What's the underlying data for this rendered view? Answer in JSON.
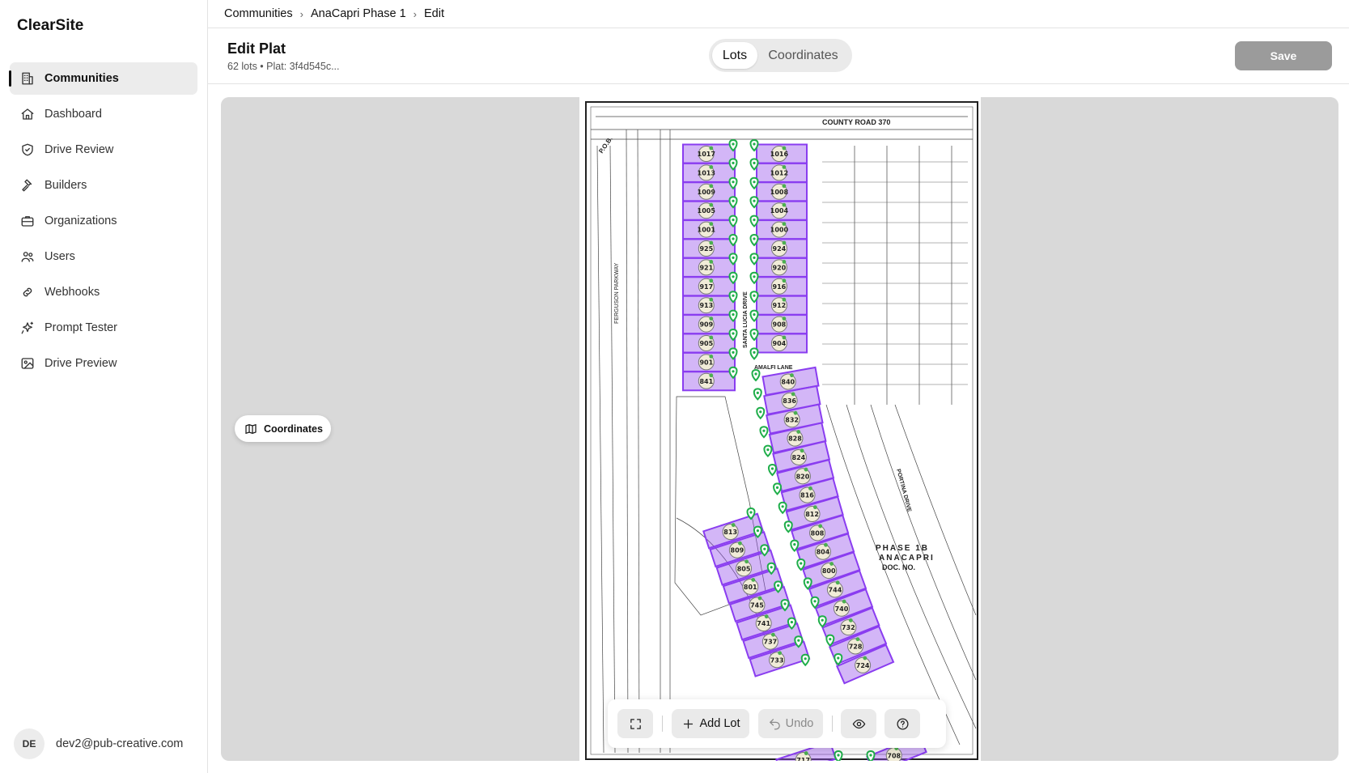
{
  "app": {
    "name": "ClearSite"
  },
  "sidebar": {
    "items": [
      {
        "label": "Communities",
        "icon": "building-icon",
        "active": true
      },
      {
        "label": "Dashboard",
        "icon": "home-icon"
      },
      {
        "label": "Drive Review",
        "icon": "shield-check-icon"
      },
      {
        "label": "Builders",
        "icon": "hammer-icon"
      },
      {
        "label": "Organizations",
        "icon": "briefcase-icon"
      },
      {
        "label": "Users",
        "icon": "users-icon"
      },
      {
        "label": "Webhooks",
        "icon": "link-icon"
      },
      {
        "label": "Prompt Tester",
        "icon": "sparkles-icon"
      },
      {
        "label": "Drive Preview",
        "icon": "image-icon"
      }
    ],
    "user": {
      "initials": "DE",
      "email": "dev2@pub-creative.com"
    }
  },
  "breadcrumb": [
    "Communities",
    "AnaCapri Phase 1",
    "Edit"
  ],
  "header": {
    "title": "Edit Plat",
    "subtitle": "62 lots • Plat: 3f4d545c...",
    "tabs": [
      {
        "label": "Lots",
        "active": true
      },
      {
        "label": "Coordinates",
        "active": false
      }
    ],
    "save_label": "Save"
  },
  "canvas": {
    "coordinates_button": "Coordinates",
    "plat_labels": {
      "county_road": "COUNTY ROAD 370",
      "parkway": "FERGUSON PARKWAY",
      "amalfi": "AMALFI LANE",
      "santa_lucia": "SANTA LUCIA DRIVE",
      "portina": "PORTINA DRIVE",
      "phase": "PHASE 1B",
      "anacapri": "ANACAPRI",
      "doc": "DOC. NO.",
      "pob": "P.O.B."
    },
    "lots_left": [
      "1017",
      "1013",
      "1009",
      "1005",
      "1001",
      "925",
      "921",
      "917",
      "913",
      "909",
      "905",
      "901",
      "841"
    ],
    "lots_right": [
      "1016",
      "1012",
      "1008",
      "1004",
      "1000",
      "924",
      "920",
      "916",
      "912",
      "908",
      "904"
    ],
    "lots_curve": [
      "840",
      "836",
      "832",
      "828",
      "824",
      "820",
      "816",
      "812",
      "808",
      "804",
      "800",
      "744",
      "740",
      "732",
      "728",
      "724"
    ],
    "lots_lower": [
      "813",
      "809",
      "805",
      "801",
      "745",
      "741",
      "737",
      "733"
    ],
    "lots_bottom": [
      "717",
      "708"
    ]
  },
  "toolbar": {
    "fit_icon": "expand-icon",
    "add_lot": "Add Lot",
    "undo": "Undo",
    "visibility_icon": "eye-icon",
    "help_icon": "help-circle-icon"
  }
}
